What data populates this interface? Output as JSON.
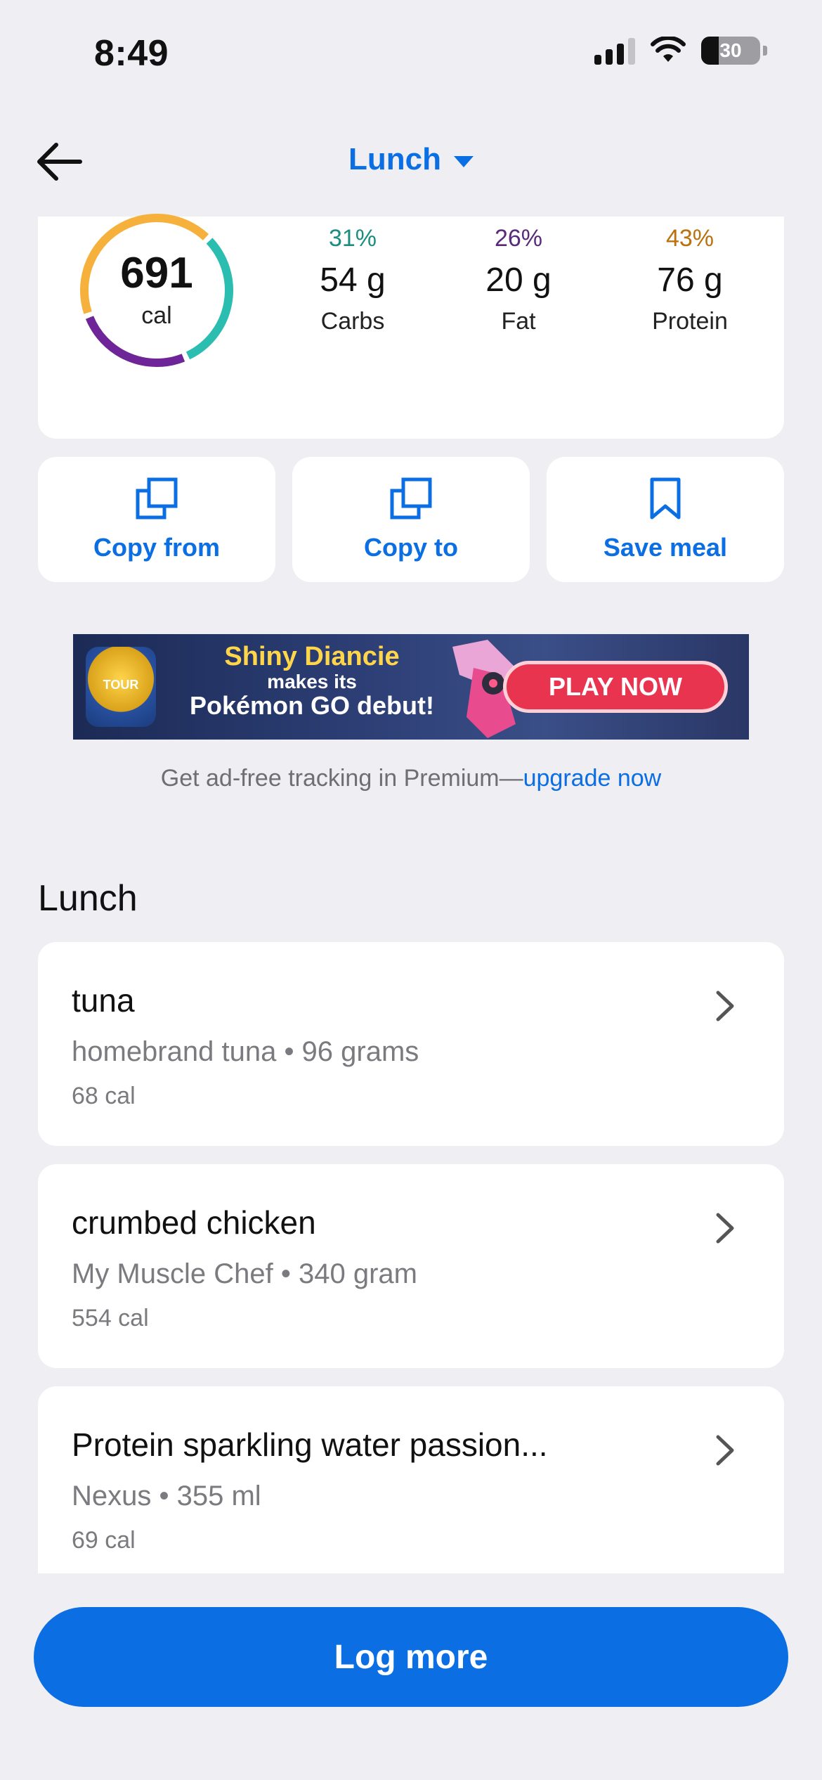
{
  "status_bar": {
    "time": "8:49",
    "battery": "30"
  },
  "header": {
    "title": "Lunch"
  },
  "summary": {
    "calories": "691",
    "calories_unit": "cal",
    "macros": [
      {
        "pct": "31%",
        "grams": "54 g",
        "name": "Carbs",
        "color": "#1b8e80"
      },
      {
        "pct": "26%",
        "grams": "20 g",
        "name": "Fat",
        "color": "#5a2a7a"
      },
      {
        "pct": "43%",
        "grams": "76 g",
        "name": "Protein",
        "color": "#b9720f"
      }
    ],
    "ring_colors": {
      "carbs": "#2bbdb0",
      "fat": "#6e2597",
      "protein": "#f5b13c"
    }
  },
  "actions": [
    {
      "label": "Copy from",
      "icon": "copy-icon"
    },
    {
      "label": "Copy to",
      "icon": "copy-icon"
    },
    {
      "label": "Save meal",
      "icon": "bookmark-icon"
    }
  ],
  "ad": {
    "logo_text": "TOUR",
    "line1": "Shiny Diancie",
    "line2": "makes its",
    "line3": "Pokémon GO debut!",
    "cta": "PLAY NOW"
  },
  "premium": {
    "text": "Get ad-free tracking in Premium—",
    "link": "upgrade now"
  },
  "section_title": "Lunch",
  "foods": [
    {
      "name": "tuna",
      "detail": "homebrand tuna • 96 grams",
      "cal": "68 cal"
    },
    {
      "name": "crumbed chicken",
      "detail": "My Muscle Chef • 340 gram",
      "cal": "554 cal"
    },
    {
      "name": "Protein sparkling  water  passion...",
      "detail": "Nexus • 355 ml",
      "cal": "69 cal"
    }
  ],
  "log_more": "Log more",
  "accent": "#0b6fe3"
}
